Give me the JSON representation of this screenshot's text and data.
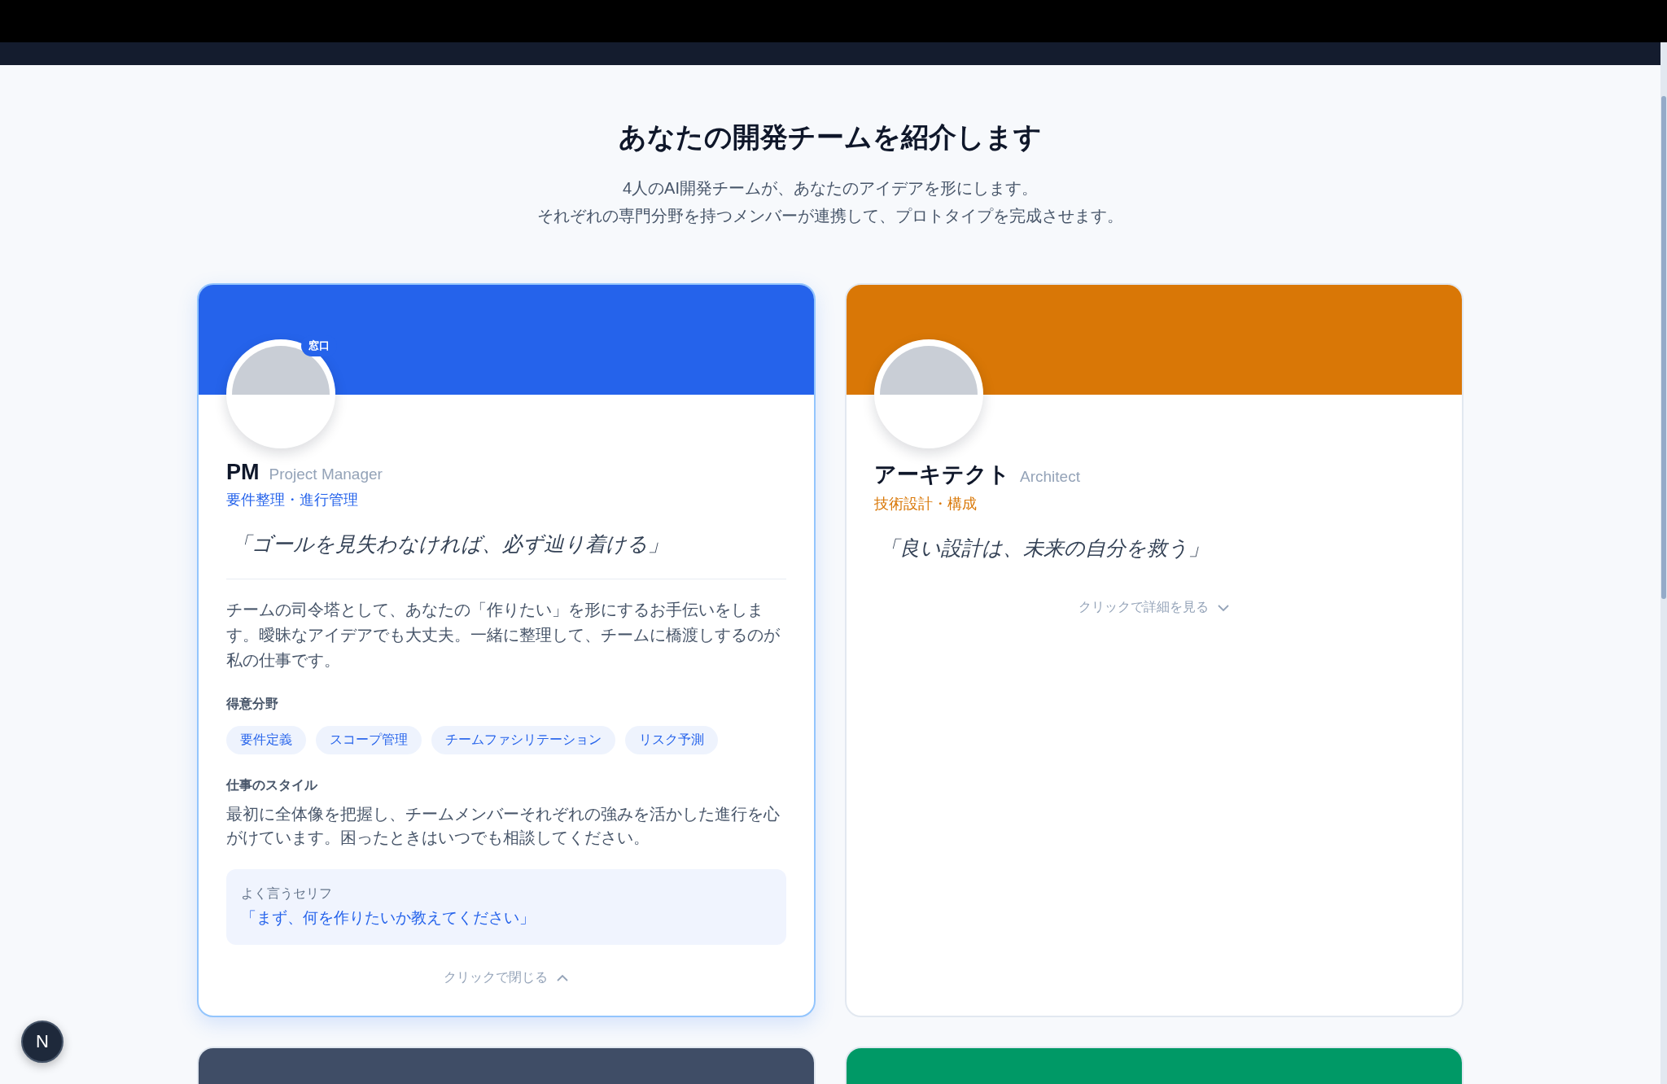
{
  "heading": {
    "title": "あなたの開発チームを紹介します",
    "subtitle": [
      "4人のAI開発チームが、あなたのアイデアを形にします。",
      "それぞれの専門分野を持つメンバーが連携して、プロトタイプを完成させます。"
    ]
  },
  "members": [
    {
      "name": "PM",
      "name_en": "Project Manager",
      "role": "要件整理・進行管理",
      "color": "#2563eb",
      "badge": "窓口",
      "quote": "「ゴールを見失わなければ、必ず辿り着ける」",
      "expanded": true,
      "description": "チームの司令塔として、あなたの「作りたい」を形にするお手伝いをします。曖昧なアイデアでも大丈夫。一緒に整理して、チームに橋渡しするのが私の仕事です。",
      "skills_label": "得意分野",
      "skills": [
        "要件定義",
        "スコープ管理",
        "チームファシリテーション",
        "リスク予測"
      ],
      "style_label": "仕事のスタイル",
      "style": "最初に全体像を把握し、チームメンバーそれぞれの強みを活かした進行を心がけています。困ったときはいつでも相談してください。",
      "phrase_label": "よく言うセリフ",
      "phrase": "「まず、何を作りたいか教えてください」",
      "toggle": "クリックで閉じる"
    },
    {
      "name": "アーキテクト",
      "name_en": "Architect",
      "role": "技術設計・構成",
      "color": "#d97706",
      "quote": "「良い設計は、未来の自分を救う」",
      "expanded": false,
      "toggle": "クリックで詳細を見る"
    },
    {
      "color": "#3f4d66"
    },
    {
      "color": "#009966"
    }
  ],
  "dev_badge": "N"
}
